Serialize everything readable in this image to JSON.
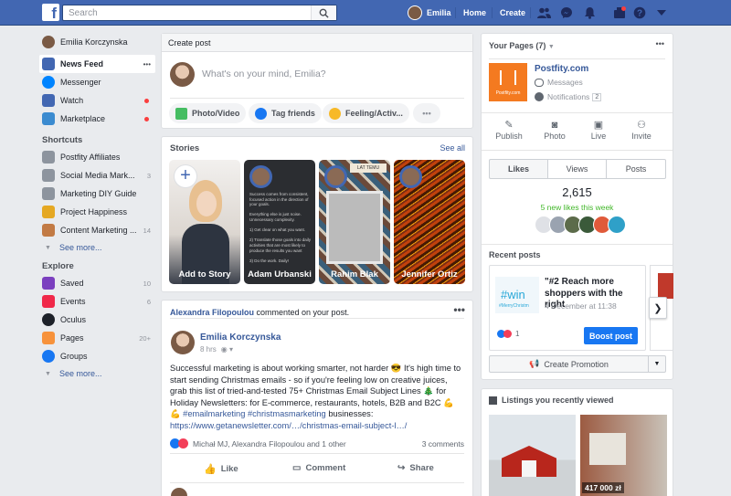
{
  "topbar": {
    "search_placeholder": "Search",
    "user_name": "Emilia",
    "home": "Home",
    "create": "Create"
  },
  "sidebar": {
    "user": "Emilia Korczynska",
    "items": [
      {
        "label": "News Feed",
        "more": "•••"
      },
      {
        "label": "Messenger"
      },
      {
        "label": "Watch"
      },
      {
        "label": "Marketplace"
      }
    ],
    "shortcuts_title": "Shortcuts",
    "shortcuts": [
      {
        "label": "Postfity Affiliates",
        "count": ""
      },
      {
        "label": "Social Media Mark...",
        "count": "3"
      },
      {
        "label": "Marketing DIY Guide",
        "count": ""
      },
      {
        "label": "Project Happiness",
        "count": ""
      },
      {
        "label": "Content Marketing ...",
        "count": "14"
      }
    ],
    "see_more": "See more...",
    "explore_title": "Explore",
    "explore": [
      {
        "label": "Saved",
        "count": "10"
      },
      {
        "label": "Events",
        "count": "6"
      },
      {
        "label": "Oculus",
        "count": ""
      },
      {
        "label": "Pages",
        "count": "20+"
      },
      {
        "label": "Groups",
        "count": ""
      }
    ],
    "explore_see_more": "See more..."
  },
  "composer": {
    "title": "Create post",
    "placeholder": "What's on your mind, Emilia?",
    "actions": [
      "Photo/Video",
      "Tag friends",
      "Feeling/Activ..."
    ],
    "more": "•••"
  },
  "stories": {
    "title": "Stories",
    "see_all": "See all",
    "add": "Add to Story",
    "items": [
      "Adam Urbanski",
      "Rahim Blak",
      "Jennifer Ortiz"
    ],
    "story_text": "Success comes from consistent, focused action in the direction of your goals.\n\nEverything else is just noise. Unnecessary complexity.\n\n1) Get clear on what you want.\n\n2) Translate those goals into daily activities that are most likely to produce the results you want\n\n3) Do the work. Daily!",
    "story_badge": "LAT TEMU"
  },
  "post": {
    "context_name": "Alexandra Filopoulou",
    "context_rest": " commented on your post.",
    "author": "Emilia Korczynska",
    "time": "8 hrs",
    "text": "Successful marketing is about working smarter, not harder 😎 It's high time to start sending Christmas emails - so if you're feeling low on creative juices, grab this list of tried-and-tested 75+ Christmas Email Subject Lines 🎄 for Holiday Newsletters: for E-commerce, restaurants, hotels, B2B and B2C 💪 💪 ",
    "hashtags": "#emailmarketing #christmasmarketing",
    "text_tail": " businesses:",
    "link": "https://www.getanewsletter.com/…/christmas-email-subject-l…/",
    "reactions": "Michał MJ, Alexandra Filopoulou and 1 other",
    "comments": "3 comments",
    "actions": [
      "Like",
      "Comment",
      "Share"
    ],
    "menu": "•••"
  },
  "pages": {
    "title": "Your Pages (7)",
    "menu": "•••",
    "page_name": "Postfity.com",
    "logo_text": "Postfity.com",
    "messages": "Messages",
    "notifications": "Notifications",
    "notif_count": "2",
    "actions": [
      "Publish",
      "Photo",
      "Live",
      "Invite"
    ],
    "tabs": [
      "Likes",
      "Views",
      "Posts"
    ],
    "likes": "2,615",
    "new_likes": "5 new likes this week",
    "recent_title": "Recent posts",
    "recent_text": "\"#2 Reach more shoppers with the right",
    "recent_date": "4 December at 11:38",
    "recent_thumb_tag": "#win",
    "recent_thumb_small": "#MerryChristm",
    "recent_reacts": "1",
    "boost": "Boost post",
    "create_promo": "Create Promotion"
  },
  "listings": {
    "title": "Listings you recently viewed",
    "price": "417 000 zł"
  },
  "colors": {
    "brand": "#4267b2",
    "link": "#365899",
    "postfity_orange": "#f47a20",
    "notification_red": "#fa3e3e",
    "new_likes_green": "#42b72a"
  }
}
